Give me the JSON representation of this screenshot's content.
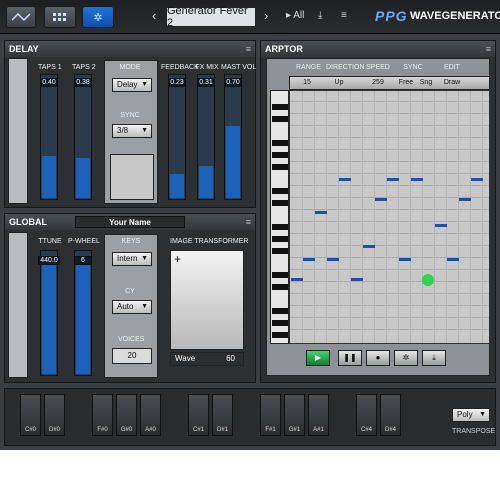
{
  "top": {
    "preset_name": "Generator Fever 2",
    "prev": "‹",
    "next": "›",
    "all_label": "All",
    "logo_text": "PPG",
    "logo_sub": "WAVEGENERATOR"
  },
  "delay": {
    "title": "DELAY",
    "taps1_label": "TAPS 1",
    "taps2_label": "TAPS 2",
    "mode_label": "MODE",
    "mode_value": "Delay",
    "sync_label": "SYNC",
    "sync_value": "3/8",
    "feedback_label": "FEEDBACK",
    "fxmix_label": "FX MIX",
    "mastervol_label": "MAST VOL",
    "taps1_value": "0.40",
    "taps2_value": "0.38",
    "feedback_value": "0.23",
    "fxmix_value": "0.31",
    "mastervol_value": "0.70"
  },
  "arptor": {
    "title": "ARPTOR",
    "range_label": "RANGE",
    "direction_label": "DIRECTION",
    "speed_label": "SPEED",
    "sync_label": "SYNC",
    "edit_label": "EDIT",
    "range_value": "15",
    "direction_value": "Up",
    "speed_value": "259",
    "sync_value1": "Free",
    "sync_value2": "Sng",
    "edit_value": "Draw"
  },
  "global": {
    "title": "GLOBAL",
    "patch_name": "Your Name",
    "ttune_label": "TTUNE",
    "pwheel_label": "P-WHEEL",
    "keys_label": "KEYS",
    "keys_value": "Intern",
    "cy_label": "CY",
    "cy_value": "Auto",
    "voices_label": "VOICES",
    "voices_value": "20",
    "ttune_value": "440.0",
    "pwheel_value": "6",
    "img_label": "IMAGE TRANSFORMER",
    "wave_label": "Wave",
    "wave_value": "60"
  },
  "keyboard": {
    "labels": [
      "C#0",
      "D#0",
      "F#0",
      "G#0",
      "A#0",
      "C#1",
      "D#1",
      "F#1",
      "G#1",
      "A#1",
      "C#4",
      "D#4"
    ],
    "poly_value": "Poly",
    "transpose_label": "TRANSPOSE"
  }
}
